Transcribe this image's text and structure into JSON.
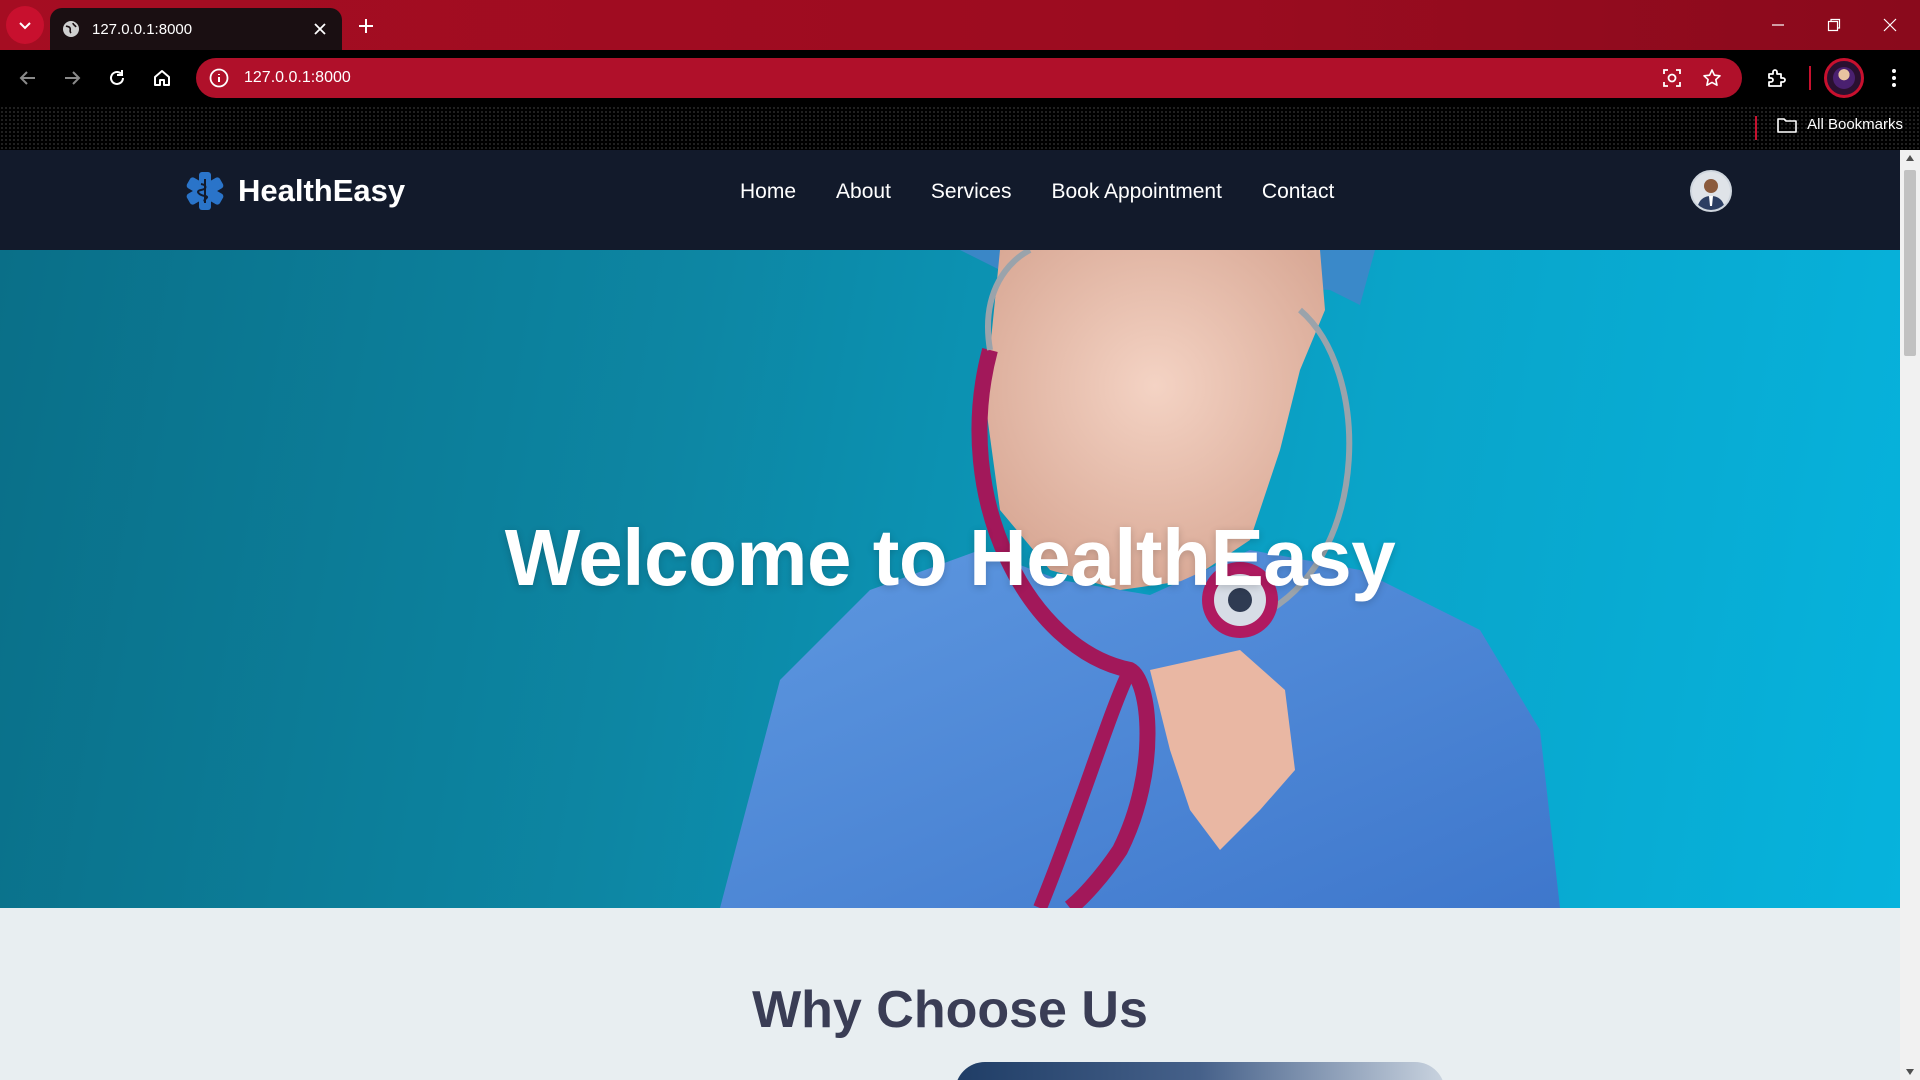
{
  "browser": {
    "tab_title": "127.0.0.1:8000",
    "url": "127.0.0.1:8000",
    "bookmarks_label": "All Bookmarks",
    "accent_color": "#a50d22"
  },
  "site": {
    "brand": "HealthEasy",
    "nav": [
      "Home",
      "About",
      "Services",
      "Book Appointment",
      "Contact"
    ],
    "header_bg": "#121a2b"
  },
  "hero": {
    "title": "Welcome to HealthEasy"
  },
  "section": {
    "heading": "Why Choose Us"
  },
  "icons": [
    "tab-search-icon",
    "globe-icon",
    "close-icon",
    "plus-icon",
    "minimize-icon",
    "restore-icon",
    "back-icon",
    "forward-icon",
    "reload-icon",
    "home-icon",
    "info-icon",
    "screenshot-lens-icon",
    "star-icon",
    "extensions-icon",
    "menu-icon",
    "folder-icon",
    "medical-star-icon"
  ]
}
